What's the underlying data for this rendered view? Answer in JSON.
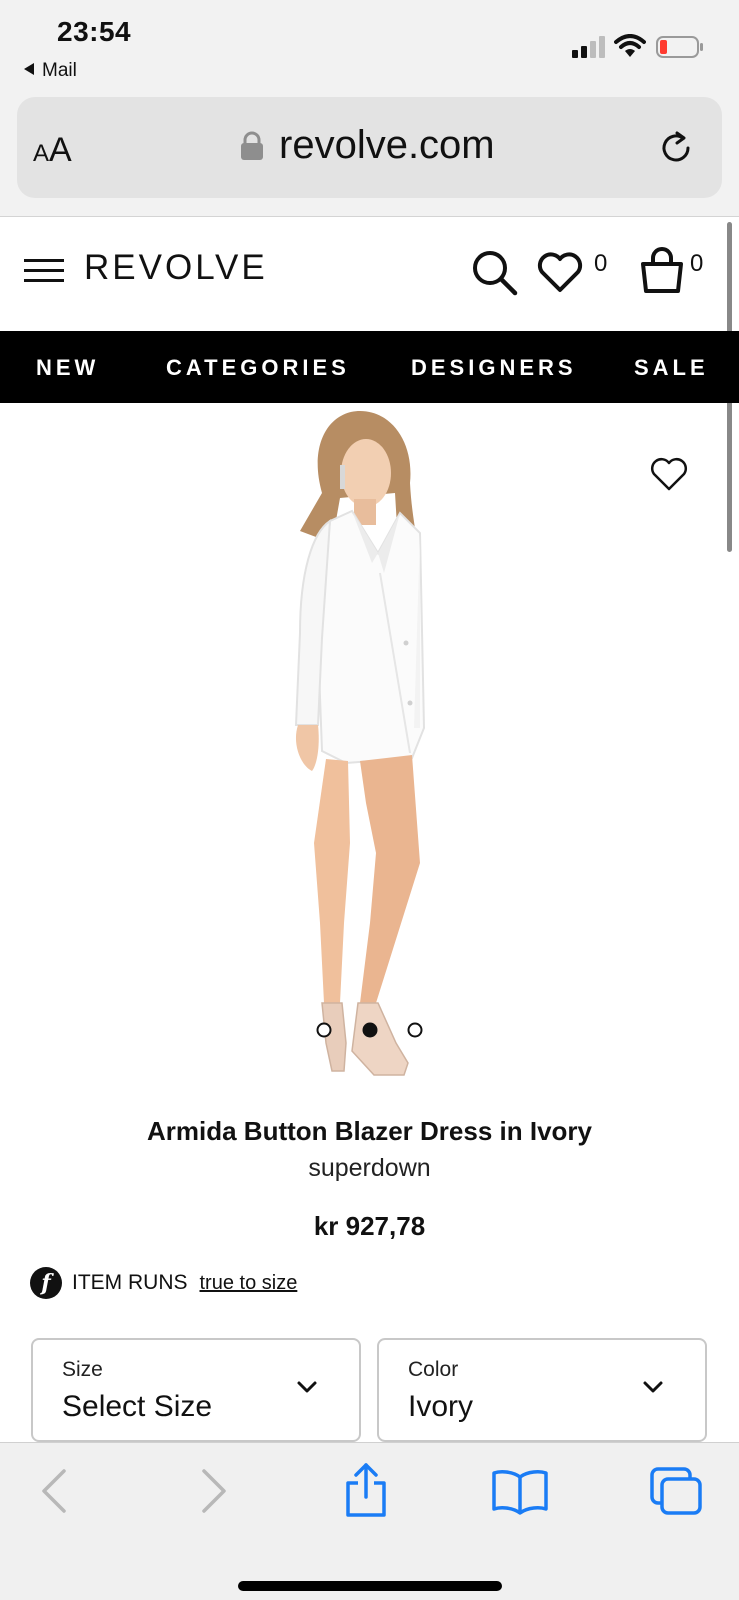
{
  "status_bar": {
    "time": "23:54",
    "back_app": "Mail"
  },
  "browser": {
    "text_size_label": "AA",
    "url": "revolve.com"
  },
  "site_header": {
    "logo": "REVOLVE",
    "wishlist_count": "0",
    "bag_count": "0"
  },
  "nav": {
    "items": [
      {
        "label": "NEW"
      },
      {
        "label": "CATEGORIES"
      },
      {
        "label": "DESIGNERS"
      },
      {
        "label": "SALE"
      }
    ]
  },
  "gallery": {
    "image_count": 3,
    "active_index": 1
  },
  "product": {
    "name": "Armida Button Blazer Dress in Ivory",
    "brand": "superdown",
    "price": "kr 927,78",
    "fit_label": "ITEM RUNS",
    "fit_value": "true to size"
  },
  "selectors": {
    "size": {
      "label": "Size",
      "value": "Select Size"
    },
    "color": {
      "label": "Color",
      "value": "Ivory"
    }
  },
  "colors": {
    "nav_bg": "#000000",
    "safari_blue": "#1a7cf5",
    "disabled_gray": "#b8b8b8",
    "battery_low": "#ff3b30"
  }
}
